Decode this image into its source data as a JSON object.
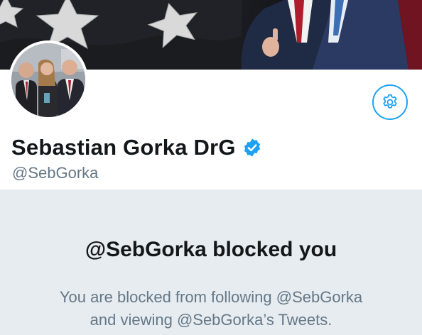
{
  "profile": {
    "display_name": "Sebastian Gorka DrG",
    "handle": "@SebGorka",
    "verified": true,
    "verified_icon": "verified-badge-icon",
    "verified_color": "#1da1f2"
  },
  "header": {
    "banner_icon": "american-flag-stars-photo",
    "avatar_icon": "profile-photo-avatar"
  },
  "actions": {
    "settings_icon": "gear-icon",
    "accent_color": "#1da1f2"
  },
  "blocked_notice": {
    "title": "@SebGorka blocked you",
    "line1": "You are blocked from following @SebGorka",
    "line2": "and viewing @SebGorka’s Tweets."
  }
}
